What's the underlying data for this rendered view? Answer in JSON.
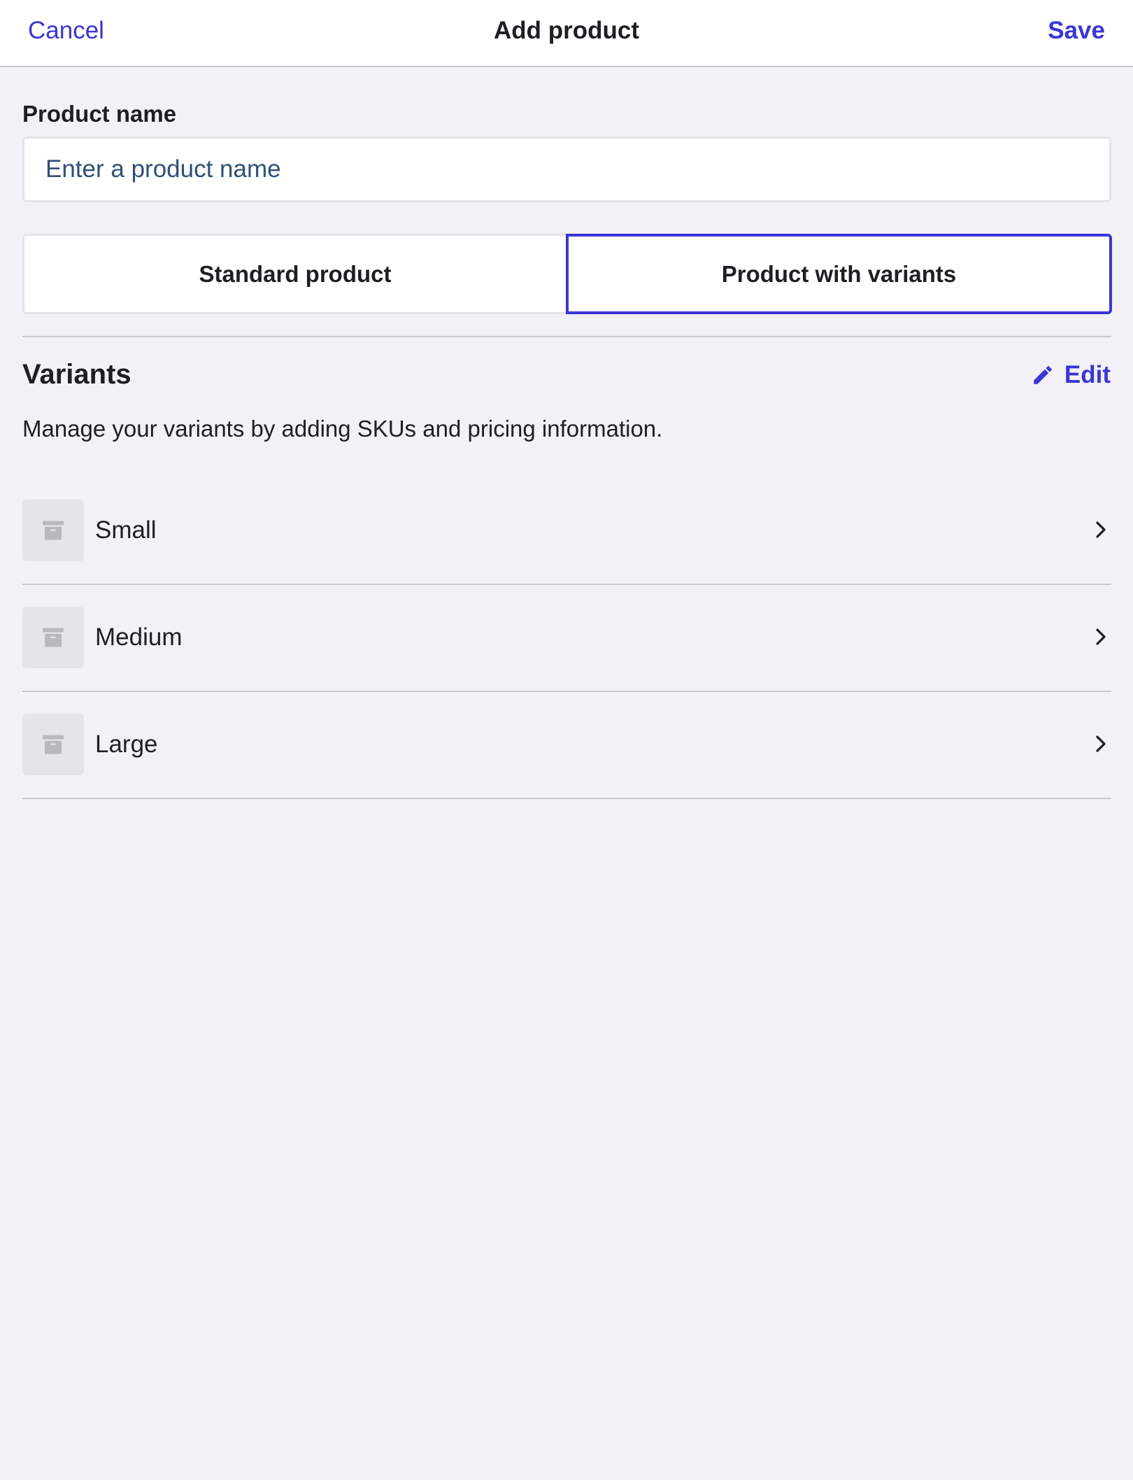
{
  "header": {
    "cancel_label": "Cancel",
    "title": "Add product",
    "save_label": "Save"
  },
  "product_name": {
    "label": "Product name",
    "placeholder": "Enter a product name",
    "value": ""
  },
  "product_type": {
    "options": [
      "Standard product",
      "Product with variants"
    ],
    "selected": "Product with variants"
  },
  "variants": {
    "title": "Variants",
    "edit_label": "Edit",
    "edit_icon": "pencil-icon",
    "description": "Manage your variants by adding SKUs and pricing information.",
    "items": [
      {
        "name": "Small",
        "icon": "archive-box-icon"
      },
      {
        "name": "Medium",
        "icon": "archive-box-icon"
      },
      {
        "name": "Large",
        "icon": "archive-box-icon"
      }
    ]
  },
  "colors": {
    "accent": "#3b35d6",
    "background": "#f2f1f5",
    "surface": "#ffffff",
    "divider": "#c9c9cf",
    "thumb_bg": "#e5e4e9"
  }
}
